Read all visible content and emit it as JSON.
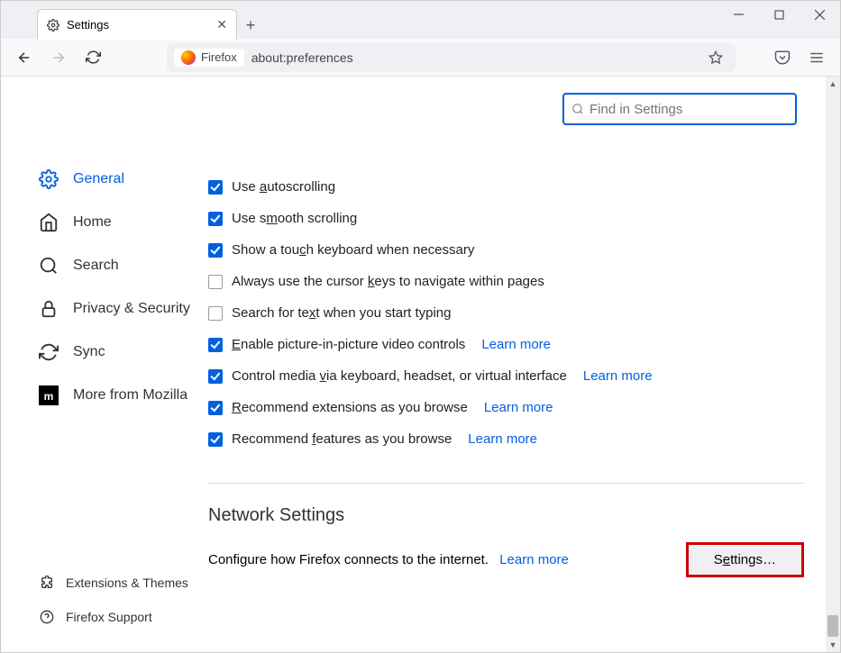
{
  "tab": {
    "title": "Settings"
  },
  "url": {
    "identity_label": "Firefox",
    "address": "about:preferences"
  },
  "search": {
    "placeholder": "Find in Settings"
  },
  "sidebar": {
    "items": [
      {
        "label": "General"
      },
      {
        "label": "Home"
      },
      {
        "label": "Search"
      },
      {
        "label": "Privacy & Security"
      },
      {
        "label": "Sync"
      },
      {
        "label": "More from Mozilla"
      }
    ],
    "bottom": [
      {
        "label": "Extensions & Themes"
      },
      {
        "label": "Firefox Support"
      }
    ]
  },
  "browsing": {
    "options": [
      {
        "checked": true,
        "pre": "Use ",
        "key": "a",
        "post": "utoscrolling"
      },
      {
        "checked": true,
        "pre": "Use s",
        "key": "m",
        "post": "ooth scrolling"
      },
      {
        "checked": true,
        "pre": "Show a tou",
        "key": "c",
        "post": "h keyboard when necessary"
      },
      {
        "checked": false,
        "pre": "Always use the cursor ",
        "key": "k",
        "post": "eys to navigate within pages"
      },
      {
        "checked": false,
        "pre": "Search for te",
        "key": "x",
        "post": "t when you start typing"
      },
      {
        "checked": true,
        "pre": "",
        "key": "E",
        "post": "nable picture-in-picture video controls",
        "learn_more": "Learn more"
      },
      {
        "checked": true,
        "pre": "Control media ",
        "key": "v",
        "post": "ia keyboard, headset, or virtual interface",
        "learn_more": "Learn more"
      },
      {
        "checked": true,
        "pre": "",
        "key": "R",
        "post": "ecommend extensions as you browse",
        "learn_more": "Learn more"
      },
      {
        "checked": true,
        "pre": "Recommend ",
        "key": "f",
        "post": "eatures as you browse",
        "learn_more": "Learn more"
      }
    ]
  },
  "network": {
    "title": "Network Settings",
    "desc": "Configure how Firefox connects to the internet.",
    "learn_more": "Learn more",
    "button_pre": "S",
    "button_key": "e",
    "button_post": "ttings…"
  }
}
